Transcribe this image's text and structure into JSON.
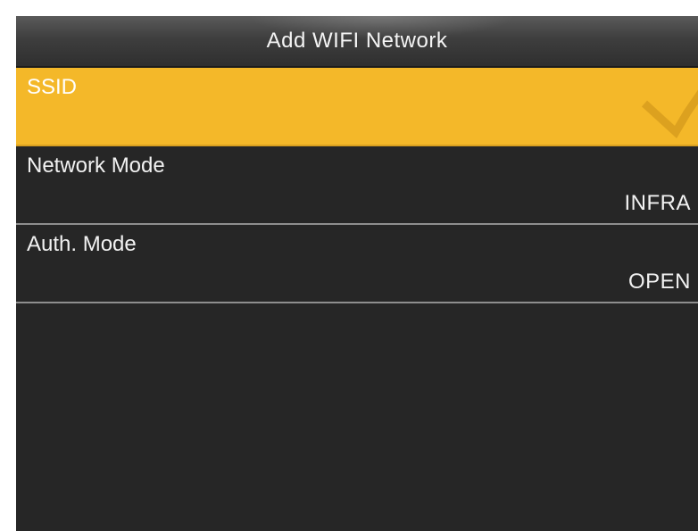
{
  "screen": {
    "title": "Add WIFI Network"
  },
  "items": [
    {
      "label": "SSID",
      "value": ""
    },
    {
      "label": "Network Mode",
      "value": "INFRA"
    },
    {
      "label": "Auth. Mode",
      "value": "OPEN"
    }
  ],
  "colors": {
    "selected_background": "#f4b829",
    "screen_background": "#262626",
    "divider": "#8e8e8e"
  }
}
